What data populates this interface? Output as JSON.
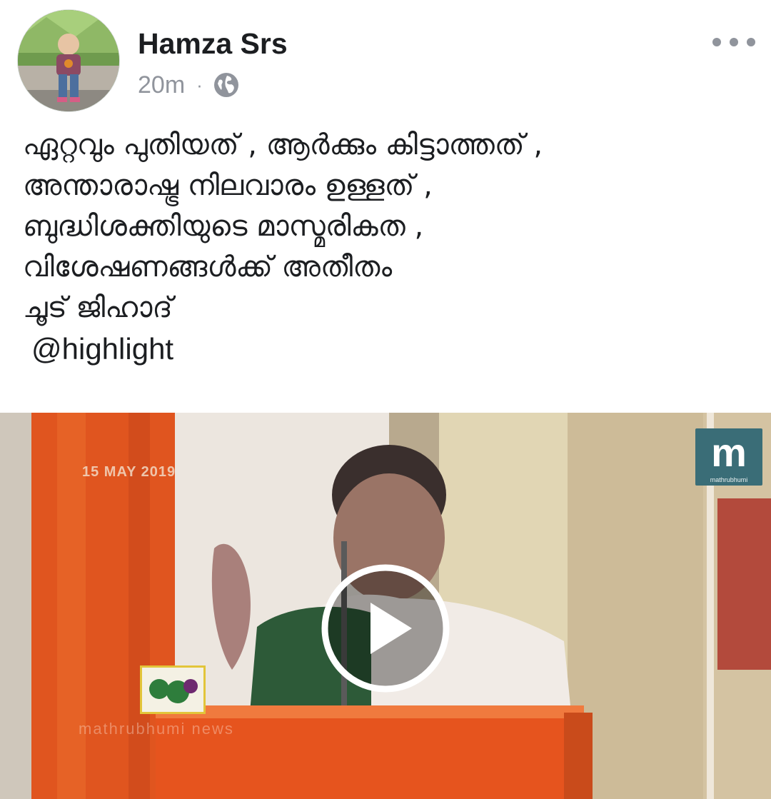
{
  "post": {
    "author_name": "Hamza Srs",
    "timestamp": "20m",
    "separator": "·",
    "privacy_icon": "globe-icon",
    "more_icon": "more-options-icon",
    "text_lines": [
      "ഏറ്റവും പുതിയത് , ആർക്കും കിട്ടാത്തത് ,",
      "അന്താരാഷ്ട്ര നിലവാരം ഉള്ളത് ,",
      "ബുദ്ധിശക്തിയുടെ മാസ്മരികത ,",
      "വിശേഷണങ്ങൾക്ക് അതീതം",
      "ചൂട് ജിഹാദ്"
    ],
    "hashtag": "@highlight"
  },
  "video": {
    "overlay_date": "15 MAY 2019",
    "channel_logo_letter": "m",
    "channel_logo_caption": "mathrubhumi",
    "watermark": "mathrubhumi news",
    "play_icon": "play-icon"
  },
  "colors": {
    "text": "#1c1e21",
    "meta": "#90949c"
  }
}
